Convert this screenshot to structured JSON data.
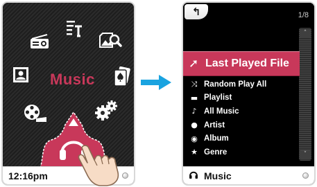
{
  "left_screen": {
    "center_label": "Music",
    "time": "12:16pm",
    "menu_icons": [
      {
        "name": "radio-icon"
      },
      {
        "name": "text-icon"
      },
      {
        "name": "photo-search-icon"
      },
      {
        "name": "contact-icon"
      },
      {
        "name": "cards-icon"
      },
      {
        "name": "video-icon"
      },
      {
        "name": "settings-icon"
      },
      {
        "name": "headphones-icon"
      }
    ],
    "accent_color": "#c8385a"
  },
  "right_screen": {
    "back_label": "↰",
    "page": "1/8",
    "highlight": {
      "icon": "➚",
      "label": "Last Played File"
    },
    "items": [
      {
        "icon": "⤨",
        "label": "Random Play All"
      },
      {
        "icon": "▬",
        "label": "Playlist"
      },
      {
        "icon": "♪",
        "label": "All Music"
      },
      {
        "icon": "●",
        "label": "Artist"
      },
      {
        "icon": "◉",
        "label": "Album"
      },
      {
        "icon": "★",
        "label": "Genre"
      }
    ],
    "now_icon": "🎧",
    "now_label": "Music",
    "scroll_up": "˄",
    "scroll_down": "˅"
  }
}
